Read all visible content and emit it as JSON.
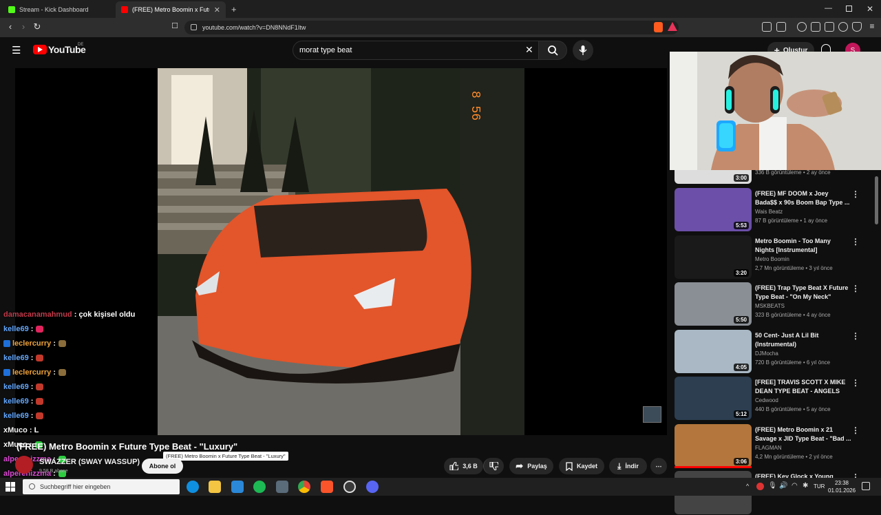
{
  "browser": {
    "tabs": [
      {
        "label": "Stream - Kick Dashboard",
        "active": false
      },
      {
        "label": "(FREE) Metro Boomin x Futur",
        "active": true
      }
    ],
    "url": "youtube.com/watch?v=DN8NNdF1Itw"
  },
  "youtube": {
    "logo": "YouTube",
    "region": "DE",
    "search_value": "morat type beat",
    "create_label": "Oluştur",
    "avatar_letter": "S"
  },
  "video": {
    "title": "(FREE) Metro Boomin x Future Type Beat - \"Luxury\"",
    "tooltip": "(FREE) Metro Boomin x Future Type Beat - \"Luxury\"",
    "channel": "SWAZZER (SWAY WASSUP)",
    "subscribers": "9,58 B abone",
    "subscribe_label": "Abone ol",
    "likes": "3,6 B",
    "share_label": "Paylaş",
    "save_label": "Kaydet",
    "download_label": "İndir",
    "overlay_digits": "8 56"
  },
  "recommendations": [
    {
      "title": "",
      "channel": "",
      "meta": "336 B görüntüleme • 2 ay önce",
      "duration": "3:00"
    },
    {
      "title": "(FREE) MF DOOM x Joey Bada$$ x 90s Boom Bap Type ...",
      "channel": "Wais Beatz",
      "meta": "87 B görüntüleme • 1 ay önce",
      "duration": "5:53"
    },
    {
      "title": "Metro Boomin - Too Many Nights [Instrumental]",
      "channel": "Metro Boomin",
      "meta": "2,7 Mn görüntüleme • 3 yıl önce",
      "duration": "3:20"
    },
    {
      "title": "(FREE) Trap Type Beat X Future Type Beat - \"On My Neck\"",
      "channel": "MSKBEATS",
      "meta": "323 B görüntüleme • 4 ay önce",
      "duration": "5:50"
    },
    {
      "title": "50 Cent- Just A Lil Bit (Instrumental)",
      "channel": "DJMocha",
      "meta": "720 B görüntüleme • 6 yıl önce",
      "duration": "4:05"
    },
    {
      "title": "[FREE] TRAVIS SCOTT X MIKE DEAN TYPE BEAT - ANGELS",
      "channel": "Cedwood",
      "meta": "440 B görüntüleme • 5 ay önce",
      "duration": "5:12"
    },
    {
      "title": "(FREE) Metro Boomin x 21 Savage x JID Type Beat - \"Bad ...",
      "channel": "FLAGMAN",
      "meta": "4,2 Mn görüntüleme • 2 yıl önce",
      "duration": "3:06"
    },
    {
      "title": "(FREE) Key Glock x Young Dolph",
      "channel": "",
      "meta": "",
      "duration": ""
    }
  ],
  "chat": [
    {
      "user": "damacanamahmud",
      "msg": ": çok kişisel oldu",
      "color": "u1",
      "badge": false,
      "emote": ""
    },
    {
      "user": "kelle69",
      "msg": ":",
      "color": "u2",
      "badge": false,
      "emote": "#e0245e"
    },
    {
      "user": "leclercurry",
      "msg": ":",
      "color": "u3",
      "badge": true,
      "emote": "#8a6d3b"
    },
    {
      "user": "kelle69",
      "msg": ":",
      "color": "u2",
      "badge": false,
      "emote": "#c0392b"
    },
    {
      "user": "leclercurry",
      "msg": ":",
      "color": "u3",
      "badge": true,
      "emote": "#8a6d3b"
    },
    {
      "user": "kelle69",
      "msg": ":",
      "color": "u2",
      "badge": false,
      "emote": "#c0392b"
    },
    {
      "user": "kelle69",
      "msg": ":",
      "color": "u2",
      "badge": false,
      "emote": "#c0392b"
    },
    {
      "user": "kelle69",
      "msg": ":",
      "color": "u2",
      "badge": false,
      "emote": "#c0392b"
    },
    {
      "user": "xMuco",
      "msg": ": L",
      "color": "u4",
      "badge": false,
      "emote": ""
    },
    {
      "user": "xMuco",
      "msg": ":",
      "color": "u4",
      "badge": false,
      "emote": "#2ecc40"
    },
    {
      "user": "alperenizzma",
      "msg": ":",
      "color": "u5",
      "badge": false,
      "emote": "#2ecc40"
    },
    {
      "user": "alperenizzma",
      "msg": ":",
      "color": "u5",
      "badge": false,
      "emote": "#2ecc40"
    },
    {
      "user": "alperenizzma",
      "msg": ":",
      "color": "u5",
      "badge": false,
      "emote": "#2ecc40"
    }
  ],
  "taskbar": {
    "search_placeholder": "Suchbegriff hier eingeben",
    "language": "TUR",
    "time": "23:38",
    "date": "01.01.2026"
  },
  "icons": [
    "youtube-logo-icon",
    "search-icon",
    "mic-icon",
    "bell-icon",
    "like-icon",
    "dislike-icon",
    "share-icon",
    "save-icon",
    "download-icon",
    "more-icon",
    "windows-start-icon"
  ]
}
